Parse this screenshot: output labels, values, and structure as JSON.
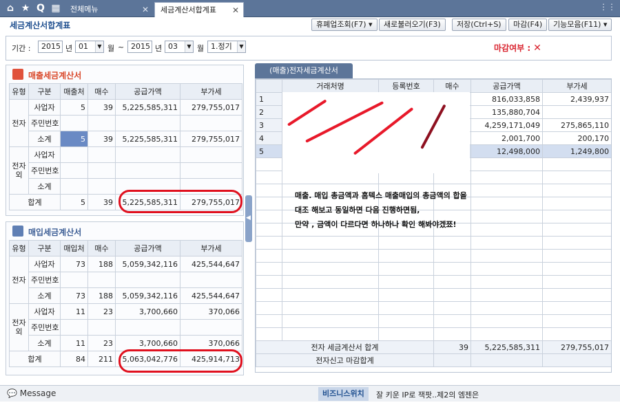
{
  "topbar": {
    "tabs": [
      {
        "label": "전체메뉴"
      },
      {
        "label": "세금계산서합계표"
      }
    ]
  },
  "title": "세금계산서합계표",
  "toolbar": {
    "buttons": [
      "휴폐업조회(F7)",
      "새로불러오기(F3)",
      "저장(Ctrl+S)",
      "마감(F4)",
      "기능모음(F11)"
    ]
  },
  "filter": {
    "period_label": "기간 :",
    "from_year": "2015",
    "from_month": "01",
    "to_year": "2015",
    "to_month": "03",
    "year_unit": "년",
    "month_unit": "월",
    "tilde": "~",
    "term": "1.정기",
    "magam_label": "마감여부 :"
  },
  "sales": {
    "title": "매출세금계산서",
    "headers": [
      "유형",
      "구분",
      "매출처",
      "매수",
      "공급가액",
      "부가세"
    ],
    "group_elec": "전자",
    "group_nonelec": "전자외",
    "rows": [
      {
        "label": "사업자",
        "count": "5",
        "sheets": "39",
        "supply": "5,225,585,311",
        "vat": "279,755,017"
      },
      {
        "label": "주민번호",
        "count": "",
        "sheets": "",
        "supply": "",
        "vat": ""
      },
      {
        "label": "소계",
        "count": "5",
        "sheets": "39",
        "supply": "5,225,585,311",
        "vat": "279,755,017"
      },
      {
        "label": "사업자",
        "count": "",
        "sheets": "",
        "supply": "",
        "vat": ""
      },
      {
        "label": "주민번호",
        "count": "",
        "sheets": "",
        "supply": "",
        "vat": ""
      },
      {
        "label": "소계",
        "count": "",
        "sheets": "",
        "supply": "",
        "vat": ""
      }
    ],
    "total": {
      "label": "합계",
      "count": "5",
      "sheets": "39",
      "supply": "5,225,585,311",
      "vat": "279,755,017"
    }
  },
  "purchase": {
    "title": "매입세금계산서",
    "headers": [
      "유형",
      "구분",
      "매입처",
      "매수",
      "공급가액",
      "부가세"
    ],
    "group_elec": "전자",
    "group_nonelec": "전자외",
    "rows": [
      {
        "label": "사업자",
        "count": "73",
        "sheets": "188",
        "supply": "5,059,342,116",
        "vat": "425,544,647"
      },
      {
        "label": "주민번호",
        "count": "",
        "sheets": "",
        "supply": "",
        "vat": ""
      },
      {
        "label": "소계",
        "count": "73",
        "sheets": "188",
        "supply": "5,059,342,116",
        "vat": "425,544,647"
      },
      {
        "label": "사업자",
        "count": "11",
        "sheets": "23",
        "supply": "3,700,660",
        "vat": "370,066"
      },
      {
        "label": "주민번호",
        "count": "",
        "sheets": "",
        "supply": "",
        "vat": ""
      },
      {
        "label": "소계",
        "count": "11",
        "sheets": "23",
        "supply": "3,700,660",
        "vat": "370,066"
      }
    ],
    "total": {
      "label": "합계",
      "count": "84",
      "sheets": "211",
      "supply": "5,063,042,776",
      "vat": "425,914,713"
    }
  },
  "detail": {
    "tab": "(매출)전자세금계산서",
    "headers": [
      "",
      "거래처명",
      "등록번호",
      "매수",
      "공급가액",
      "부가세"
    ],
    "rows": [
      {
        "no": "1",
        "supply": "816,033,858",
        "vat": "2,439,937"
      },
      {
        "no": "2",
        "supply": "135,880,704",
        "vat": ""
      },
      {
        "no": "3",
        "supply": "4,259,171,049",
        "vat": "275,865,110"
      },
      {
        "no": "4",
        "supply": "2,001,700",
        "vat": "200,170"
      },
      {
        "no": "5",
        "supply": "12,498,000",
        "vat": "1,249,800"
      }
    ],
    "note_lines": [
      "매출. 매입 총금액과 홈텍스 매출매입의 총금액의 합을",
      "대조 해보고 동일하면 다음 진행하면됨,",
      "만약 , 금액이 다르다면 하나하나 확인 해봐야겠쬬!"
    ],
    "sum_label": "전자 세금계산서 합계",
    "sum_sheets": "39",
    "sum_supply": "5,225,585,311",
    "sum_vat": "279,755,017",
    "report_label": "전자신고 마감합계"
  },
  "status": {
    "message": "Message",
    "biz": "비즈니스위치",
    "ticker": "잘 키운 IP로 잭팟..제2의 엠젠은"
  }
}
